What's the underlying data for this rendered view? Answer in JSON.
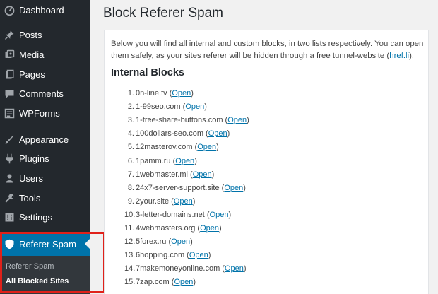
{
  "sidebar": {
    "items": [
      {
        "label": "Dashboard",
        "icon": "dashboard-icon"
      },
      {
        "label": "Posts",
        "icon": "pin-icon"
      },
      {
        "label": "Media",
        "icon": "media-icon"
      },
      {
        "label": "Pages",
        "icon": "pages-icon"
      },
      {
        "label": "Comments",
        "icon": "comment-icon"
      },
      {
        "label": "WPForms",
        "icon": "form-icon"
      },
      {
        "label": "Appearance",
        "icon": "paintbrush-icon"
      },
      {
        "label": "Plugins",
        "icon": "plugin-icon"
      },
      {
        "label": "Users",
        "icon": "users-icon"
      },
      {
        "label": "Tools",
        "icon": "wrench-icon"
      },
      {
        "label": "Settings",
        "icon": "settings-icon"
      }
    ],
    "active": {
      "label": "Referer Spam",
      "icon": "shield-icon"
    },
    "submenu": [
      "Referer Spam",
      "All Blocked Sites"
    ]
  },
  "main": {
    "title": "Block Referer Spam",
    "intro": "Below you will find all internal and custom blocks, in two lists respectively. You can open them safely, as your sites referer will be hidden through a free tunnel-website (",
    "intro_link": "href.li",
    "intro_end": ").",
    "section_title": "Internal Blocks",
    "open_label": "Open",
    "blocks": [
      "0n-line.tv",
      "1-99seo.com",
      "1-free-share-buttons.com",
      "100dollars-seo.com",
      "12masterov.com",
      "1pamm.ru",
      "1webmaster.ml",
      "24x7-server-support.site",
      "2your.site",
      "3-letter-domains.net",
      "4webmasters.org",
      "5forex.ru",
      "6hopping.com",
      "7makemoneyonline.com",
      "7zap.com"
    ]
  },
  "colors": {
    "sidebar": "#23282d",
    "active": "#0073aa",
    "link": "#0073aa",
    "highlight": "#e0211a"
  }
}
